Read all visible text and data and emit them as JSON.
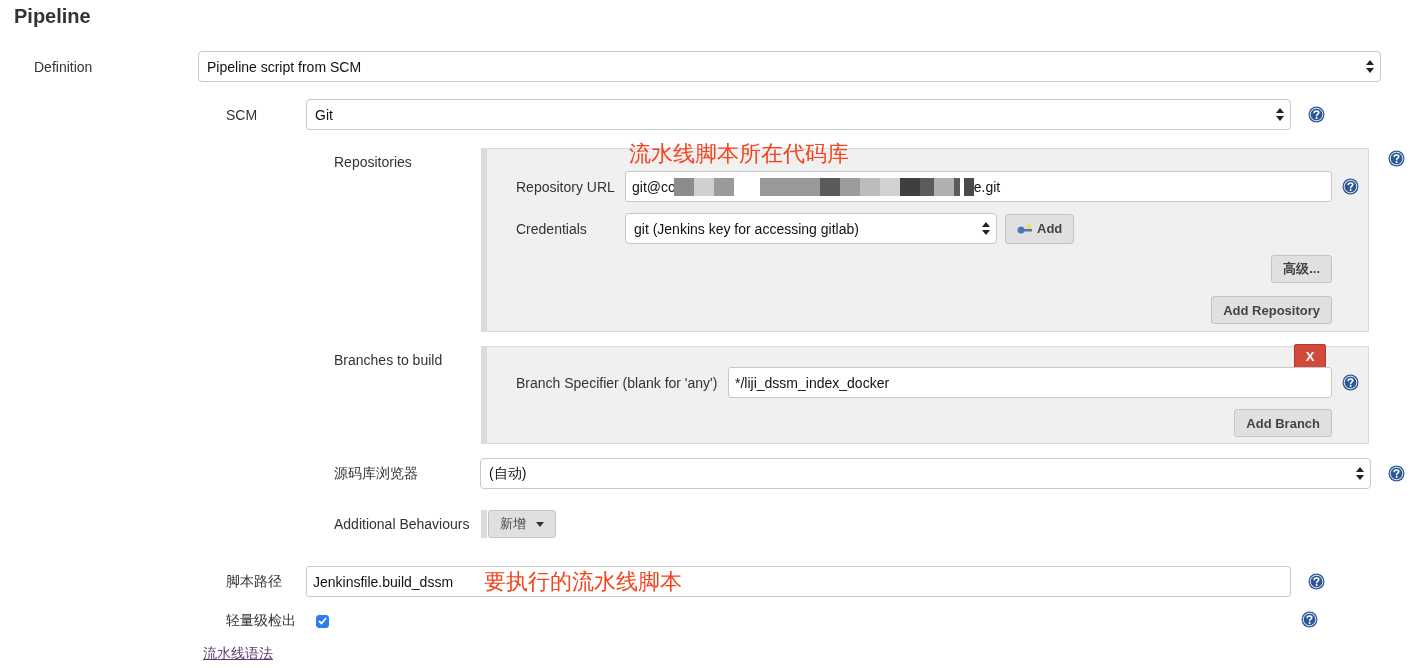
{
  "title": "Pipeline",
  "definition": {
    "label": "Definition",
    "value": "Pipeline script from SCM"
  },
  "scm": {
    "label": "SCM",
    "value": "Git"
  },
  "repositories": {
    "label": "Repositories",
    "annotation": "流水线脚本所在代码库",
    "url": {
      "label": "Repository URL",
      "value_start": "git@co",
      "value_end": "e.git"
    },
    "credentials": {
      "label": "Credentials",
      "value": "git (Jenkins key for accessing gitlab)",
      "add_button": "Add"
    },
    "advanced_button": "高级...",
    "add_repository_button": "Add Repository"
  },
  "branches": {
    "label": "Branches to build",
    "delete_button": "X",
    "specifier": {
      "label": "Branch Specifier (blank for 'any')",
      "value": "*/liji_dssm_index_docker"
    },
    "add_branch_button": "Add Branch"
  },
  "browser": {
    "label": "源码库浏览器",
    "value": "(自动)"
  },
  "behaviours": {
    "label": "Additional Behaviours",
    "add_button": "新增"
  },
  "script_path": {
    "label": "脚本路径",
    "value": "Jenkinsfile.build_dssm",
    "annotation": "要执行的流水线脚本"
  },
  "lightweight": {
    "label": "轻量级检出",
    "checked": true
  },
  "syntax_link": "流水线语法"
}
